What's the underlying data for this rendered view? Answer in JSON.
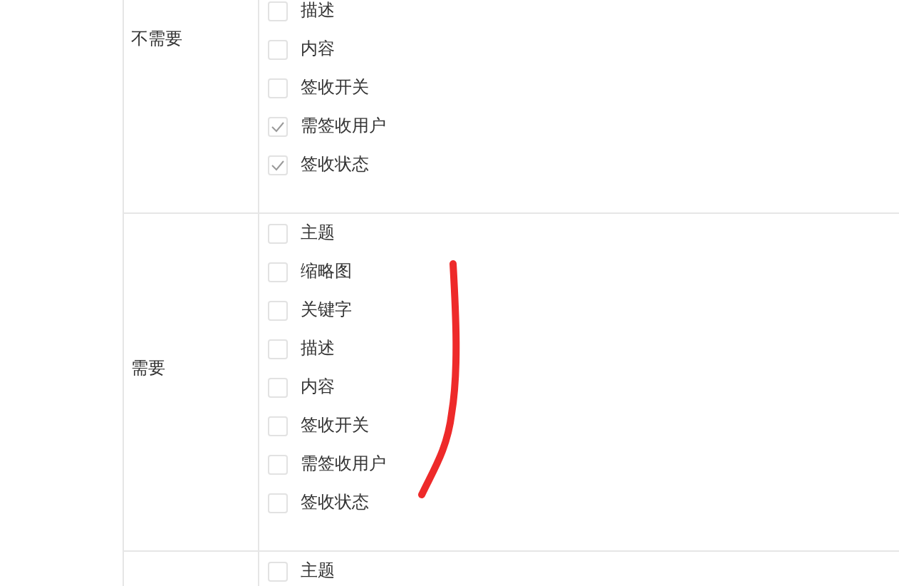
{
  "rows": [
    {
      "label": "不需要",
      "options": [
        {
          "label": "描述",
          "checked": false
        },
        {
          "label": "内容",
          "checked": false
        },
        {
          "label": "签收开关",
          "checked": false
        },
        {
          "label": "需签收用户",
          "checked": true
        },
        {
          "label": "签收状态",
          "checked": true
        }
      ]
    },
    {
      "label": "需要",
      "options": [
        {
          "label": "主题",
          "checked": false
        },
        {
          "label": "缩略图",
          "checked": false
        },
        {
          "label": "关键字",
          "checked": false
        },
        {
          "label": "描述",
          "checked": false
        },
        {
          "label": "内容",
          "checked": false
        },
        {
          "label": "签收开关",
          "checked": false
        },
        {
          "label": "需签收用户",
          "checked": false
        },
        {
          "label": "签收状态",
          "checked": false
        }
      ]
    },
    {
      "options": [
        {
          "label": "主题",
          "checked": false
        }
      ]
    }
  ]
}
